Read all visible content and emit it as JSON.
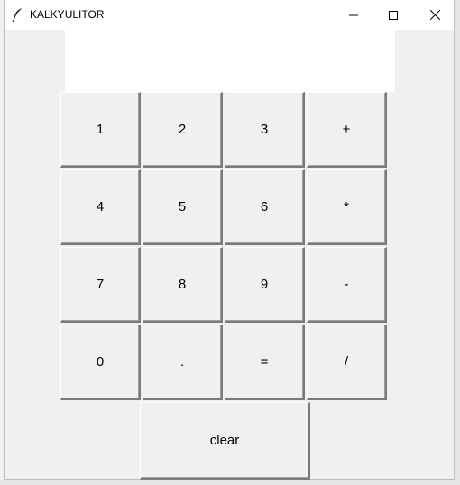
{
  "window": {
    "title": "KALKYULITOR",
    "icon": "feather-icon",
    "controls": [
      "minimize-icon",
      "maximize-icon",
      "close-icon"
    ]
  },
  "display": {
    "value": ""
  },
  "keypad": {
    "rows": [
      [
        "1",
        "2",
        "3",
        "+"
      ],
      [
        "4",
        "5",
        "6",
        "*"
      ],
      [
        "7",
        "8",
        "9",
        "-"
      ],
      [
        "0",
        ".",
        "=",
        "/"
      ]
    ],
    "clear_label": "clear"
  }
}
